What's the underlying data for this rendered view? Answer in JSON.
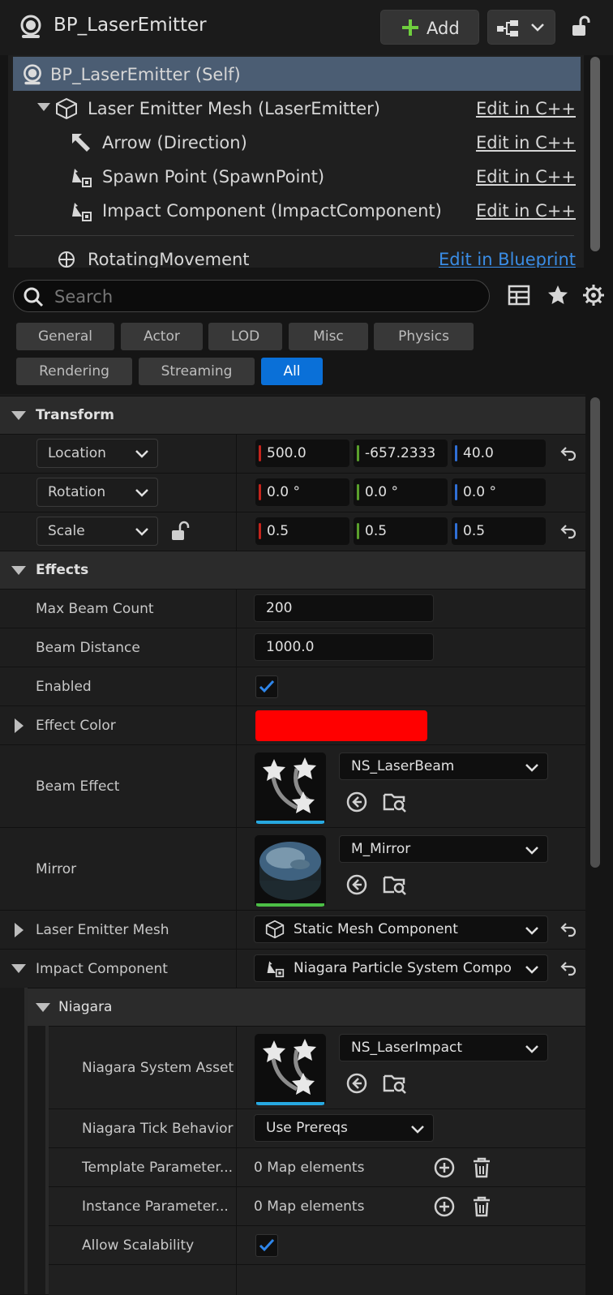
{
  "header": {
    "title": "BP_LaserEmitter",
    "add_label": "Add"
  },
  "tree": {
    "items": [
      {
        "label": "BP_LaserEmitter (Self)",
        "edit": ""
      },
      {
        "label": "Laser Emitter Mesh (LaserEmitter)",
        "edit": "Edit in C++"
      },
      {
        "label": "Arrow (Direction)",
        "edit": "Edit in C++"
      },
      {
        "label": "Spawn Point (SpawnPoint)",
        "edit": "Edit in C++"
      },
      {
        "label": "Impact Component (ImpactComponent)",
        "edit": "Edit in C++"
      },
      {
        "label": "RotatingMovement",
        "edit": "Edit in Blueprint"
      }
    ]
  },
  "search": {
    "placeholder": "Search"
  },
  "filters": [
    "General",
    "Actor",
    "LOD",
    "Misc",
    "Physics",
    "Rendering",
    "Streaming",
    "All"
  ],
  "transform": {
    "title": "Transform",
    "location": {
      "label": "Location",
      "x": "500.0",
      "y": "-657.2333",
      "z": "40.0"
    },
    "rotation": {
      "label": "Rotation",
      "x": "0.0 °",
      "y": "0.0 °",
      "z": "0.0 °"
    },
    "scale": {
      "label": "Scale",
      "x": "0.5",
      "y": "0.5",
      "z": "0.5"
    }
  },
  "effects": {
    "title": "Effects",
    "max_beam_count": {
      "label": "Max Beam Count",
      "value": "200"
    },
    "beam_distance": {
      "label": "Beam Distance",
      "value": "1000.0"
    },
    "enabled": {
      "label": "Enabled",
      "checked": true
    },
    "effect_color": {
      "label": "Effect Color",
      "color": "#ff0000"
    },
    "beam_effect": {
      "label": "Beam Effect",
      "asset": "NS_LaserBeam"
    },
    "mirror": {
      "label": "Mirror",
      "asset": "M_Mirror"
    },
    "laser_emitter_mesh": {
      "label": "Laser Emitter Mesh",
      "value": "Static Mesh Component"
    },
    "impact_component": {
      "label": "Impact Component",
      "value": "Niagara Particle System Compo"
    }
  },
  "niagara": {
    "title": "Niagara",
    "system_asset": {
      "label": "Niagara System Asset",
      "asset": "NS_LaserImpact"
    },
    "tick_behavior": {
      "label": "Niagara Tick Behavior",
      "value": "Use Prereqs"
    },
    "template_params": {
      "label": "Template Parameter...",
      "value": "0 Map elements"
    },
    "instance_params": {
      "label": "Instance Parameter...",
      "value": "0 Map elements"
    },
    "allow_scalability": {
      "label": "Allow Scalability",
      "checked": true
    }
  },
  "colors": {
    "accent": "#0a70d8",
    "selection": "#4b5d73",
    "x_axis": "#c4241c",
    "y_axis": "#5aa02c",
    "z_axis": "#2f6fd6",
    "effect_color": "#ff0000"
  }
}
